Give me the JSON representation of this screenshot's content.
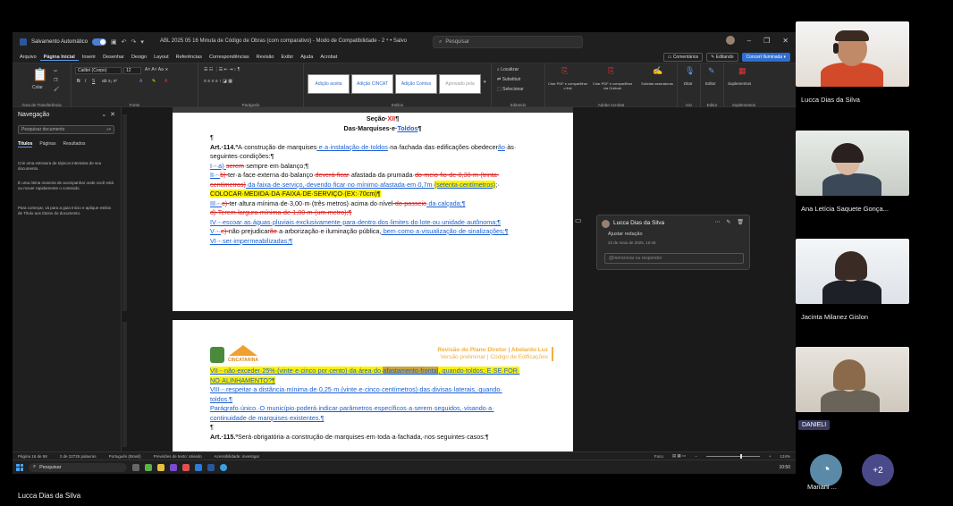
{
  "titlebar": {
    "autosave_label": "Salvamento Automático",
    "document_title": "ABL 2025 05 16 Minuta de Código de Obras (com comparativo) - Modo de Compatibilidade - 2 ⁴ • Salvo",
    "search_placeholder": "Pesquisar"
  },
  "menubar": {
    "tabs": [
      "Arquivo",
      "Página Inicial",
      "Inserir",
      "Desenhar",
      "Design",
      "Layout",
      "Referências",
      "Correspondências",
      "Revisão",
      "Exibir",
      "Ajuda",
      "Acrobat"
    ],
    "comments_label": "Comentários",
    "editing_label": "Editando",
    "share_label": "Concert Iluminada"
  },
  "ribbon": {
    "paste_label": "Colar",
    "clipboard_label": "Área de Transferência",
    "font_name": "Calibri (Corpo)",
    "font_size": "12",
    "font_group_label": "Fonte",
    "paragraph_label": "Parágrafo",
    "styles": [
      "Adição aceita",
      "Adição CINCAT",
      "Adição Comiss",
      "Aprovado pela"
    ],
    "styles_label": "Estilos",
    "find_label": "Localizar",
    "replace_label": "Substituir",
    "select_label": "Selecionar",
    "editing_group_label": "Editando",
    "acrobat_buttons": [
      "Criar PDF e compartilhar o link",
      "Criar PDF e compartilhar via Outlook",
      "Solicitar assinaturas"
    ],
    "acrobat_label": "Adobe Acrobat",
    "dictate_label": "Ditar",
    "voice_label": "Voz",
    "editor_label": "Editor",
    "addins_label": "Suplementos"
  },
  "nav": {
    "title": "Navegação",
    "search_placeholder": "Pesquisar documento",
    "tabs": [
      "Títulos",
      "Páginas",
      "Resultados"
    ],
    "text1": "Crie uma estrutura de tópicos interativa de seu documento.",
    "text2": "É uma ótima maneira de acompanhar onde você está ou mover rapidamente o conteúdo.",
    "text3": "Para começar, vá para a guia Início e aplique estilos de Título aos títulos do documento."
  },
  "page1": {
    "heading1_a": "Seção·",
    "heading1_b": "XII",
    "heading1_c": "¶",
    "heading2_a": "Das·Marquises·e·",
    "heading2_b": "Toldos",
    "heading2_c": "¶",
    "pilcrow": "¶",
    "l1_a": "Art.·114.º",
    "l1_b": "A·construção·de·marquises",
    "l1_c": "·e·a·instalação·de·toldos",
    "l1_d": "·na·fachada·das·edificações·obedecer",
    "l1_e": "ão",
    "l1_f": "·às·",
    "l2": "seguintes·condições:¶",
    "l3_a": "I·-·a)·",
    "l3_b": "serem",
    "l3_c": "·sempre·em·balanço;¶",
    "l4_a": "II·-·",
    "l4_b": "b)·",
    "l4_c": "ter·a·face·externa·do·balanço·",
    "l4_d": "deverá·ficar",
    "l4_e": "·afastada·da·prumada·",
    "l4_f": "do·meio-fio·de·0,30·m·(trinta·",
    "l5_a": "centímetros)",
    "l5_b": "·da·faixa·de·serviço,·devendo·ficar·no·mínimo·afastada·em·0,7m·",
    "l5_c": "(setenta·centímetros)",
    "l5_d": ";·",
    "l6": "COLOCAR·MEDIDA·DA·FAIXA·DE·SERVIÇO·(EX:·70cm)¶",
    "l7_a": "III·-·",
    "l7_b": "c)·",
    "l7_c": "ter·altura·mínima·de·3,00·m·(três·metros)·acima·do·nível",
    "l7_d": "·do·passeio",
    "l7_e": "·da·calçada;¶",
    "l8": "d)·Terem·largura·mínima·de·1,00·m·(um·metro);¶",
    "l9": "IV·-·escoar·as·águas·pluviais·exclusivamente·para·dentro·dos·limites·do·lote·ou·unidade·autônoma;¶",
    "l10_a": "V·-·",
    "l10_b": "e)·",
    "l10_c": "não·prejudicar",
    "l10_d": "ão",
    "l10_e": "·a·arborização·e·iluminação·pública,",
    "l10_f": "·bem·como·a·visualização·de·sinalizações;¶",
    "l11": "VI·-·ser·impermeabilizadas;¶"
  },
  "page2": {
    "brand": "CINCATARINA",
    "header_title": "Revisão do Plano Diretor | Abelardo Luz",
    "header_sub": "Versão preliminar | Código de Edificações",
    "l1_a": "VII·-·não·exceder·25%·(vinte·e·cinco·por·cento)·da·área·do·",
    "l1_b": "afastamento·frontal",
    "l1_c": ",·quando·toldos;·E·SE·FOR·",
    "l2": "NO·ALINHAMENTO?¶",
    "l3": "VIII·-·respeitar·a·distância·mínima·de·0,25·m·(vinte·e·cinco·centímetros)·das·divisas·laterais,·quando·",
    "l4": "toldos.¶",
    "l5": "Parágrafo·único.·O·município·poderá·indicar·parâmetros·específicos·a·serem·seguidos,·visando·a·",
    "l6": "continuidade·de·marquises·existentes.¶",
    "pilcrow": "¶",
    "l7_a": "Art.·115.º",
    "l7_b": "Será·obrigatória·a·construção·de·marquises·em·toda·a·fachada,·nos·seguintes·casos:¶"
  },
  "comment": {
    "author": "Lucca Dias da Silva",
    "body": "Ajustar redação",
    "date": "23 de maio de 2025, 10:46",
    "reply_placeholder": "@mencionar ou responder"
  },
  "statusbar": {
    "page": "Página 16 de 58",
    "words": "2 de 22725 palavras",
    "language": "Português (Brasil)",
    "predictions": "Previsões de texto: ativado",
    "accessibility": "Acessibilidade: investigar",
    "focus": "Foco",
    "zoom": "124%"
  },
  "taskbar": {
    "search_label": "Pesquisar",
    "time": "10:50"
  },
  "participants": {
    "p1": "Lucca Dias da Silva",
    "p2": "Ana Letícia Saquete Gonça...",
    "p3": "Jacinta Milanez Gislon",
    "p4_badge": "DANIELI",
    "p5": "Mariani ...",
    "more": "+2"
  },
  "bottom_caption": "Lucca Dias da Silva",
  "colors": {
    "accent": "#2f6dcf",
    "insertion": "#1a5fd3",
    "deletion": "#d22222",
    "highlight": "#fff200"
  }
}
